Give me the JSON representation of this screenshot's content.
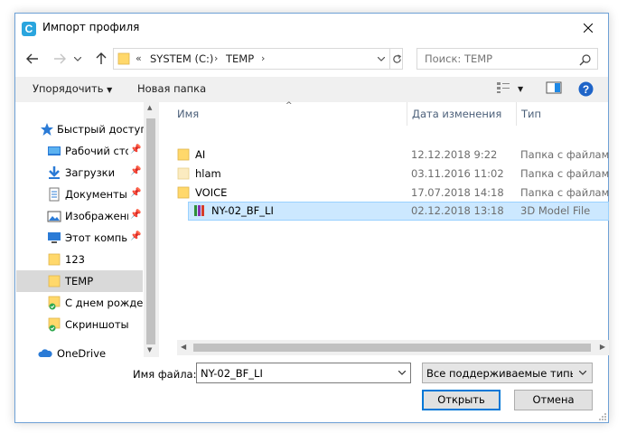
{
  "window": {
    "title": "Импорт профиля",
    "app_icon": "C"
  },
  "address": {
    "overflow": "«",
    "crumbs": [
      "SYSTEM (C:)",
      "TEMP"
    ],
    "search_placeholder": "Поиск: TEMP"
  },
  "toolbar": {
    "organize": "Упорядочить",
    "new_folder": "Новая папка"
  },
  "nav": {
    "items": [
      {
        "label": "Быстрый доступ",
        "icon": "star-icon"
      },
      {
        "label": "Рабочий сто",
        "icon": "desktop-icon",
        "pinned": true
      },
      {
        "label": "Загрузки",
        "icon": "download-icon",
        "pinned": true
      },
      {
        "label": "Документы",
        "icon": "documents-icon",
        "pinned": true
      },
      {
        "label": "Изображени",
        "icon": "pictures-icon",
        "pinned": true
      },
      {
        "label": "Этот компьк",
        "icon": "computer-icon",
        "pinned": true
      },
      {
        "label": "123",
        "icon": "folder-icon"
      },
      {
        "label": "TEMP",
        "icon": "folder-icon"
      },
      {
        "label": "С днем рожден",
        "icon": "folder-sync-icon"
      },
      {
        "label": "Скриншоты",
        "icon": "folder-sync-icon"
      },
      {
        "label": "OneDrive",
        "icon": "cloud-icon"
      }
    ]
  },
  "columns": {
    "name": "Имя",
    "date": "Дата изменения",
    "type": "Тип"
  },
  "files": [
    {
      "name": "AI",
      "date": "12.12.2018 9:22",
      "type": "Папка с файлами",
      "icon": "folder-icon"
    },
    {
      "name": "hlam",
      "date": "03.11.2016 11:02",
      "type": "Папка с файлами",
      "icon": "folder-icon"
    },
    {
      "name": "VOICE",
      "date": "17.07.2018 14:18",
      "type": "Папка с файлами",
      "icon": "folder-icon"
    },
    {
      "name": "NY-02_BF_LI",
      "date": "02.12.2018 13:18",
      "type": "3D Model File",
      "icon": "model-file-icon"
    }
  ],
  "bottom": {
    "filename_label": "Имя файла:",
    "filename_value": "NY-02_BF_LI",
    "filetype": "Все поддерживаемые типы (*.",
    "open": "Открыть",
    "cancel": "Отмена"
  },
  "colors": {
    "accent": "#0078d7",
    "selection": "#cce8ff",
    "folder": "#ffd86b"
  }
}
